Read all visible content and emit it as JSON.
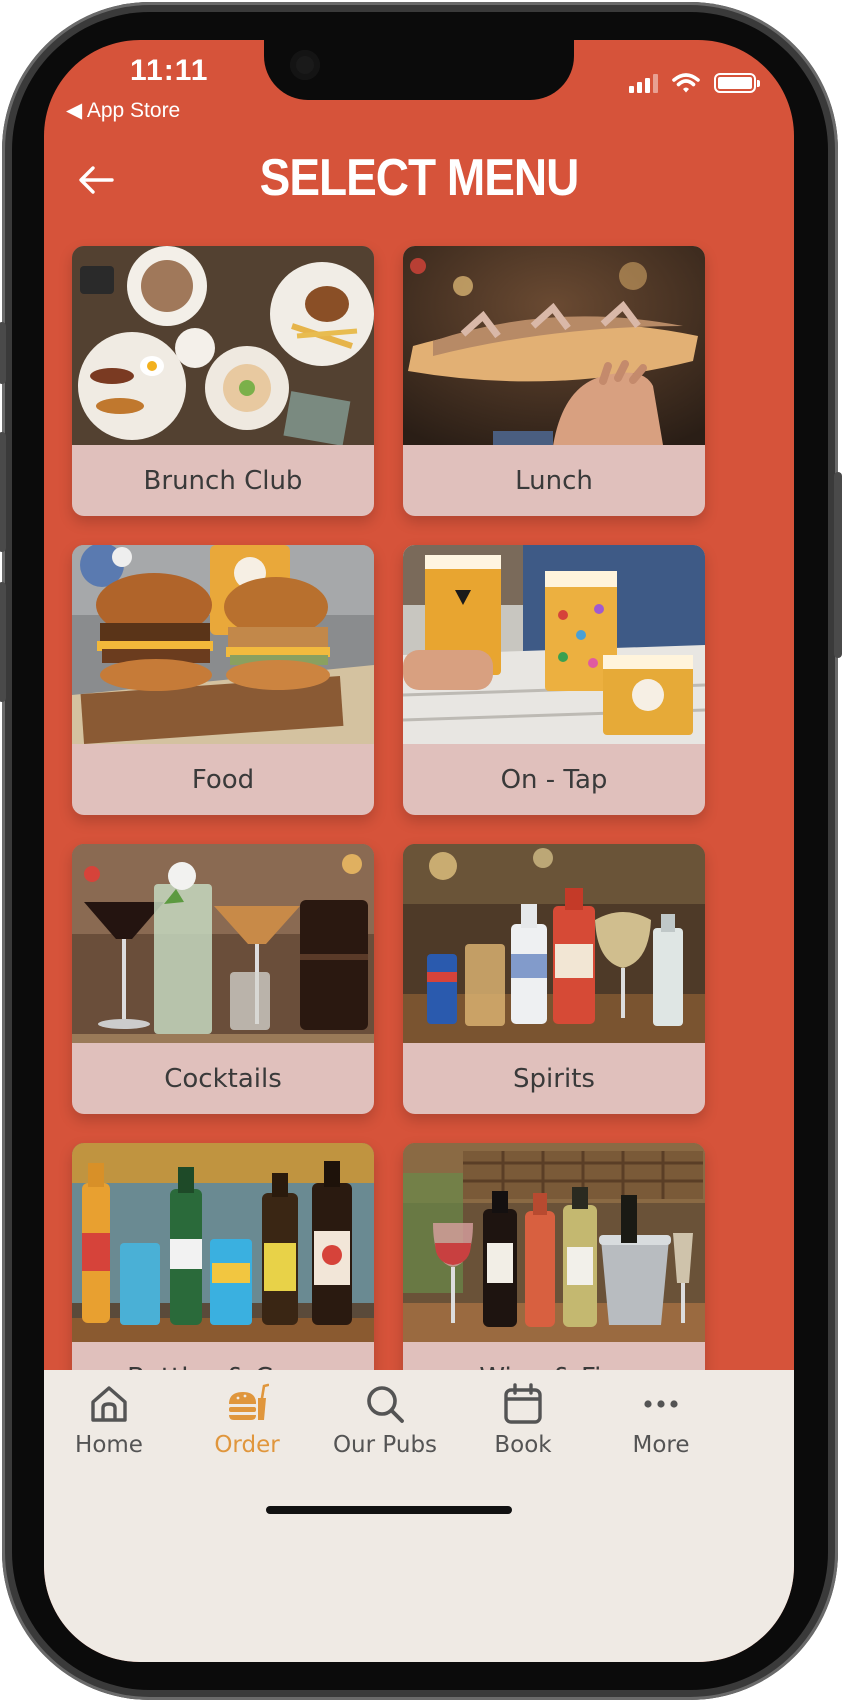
{
  "status_bar": {
    "time": "11:11",
    "back_app": "App Store"
  },
  "header": {
    "title": "SELECT MENU"
  },
  "colors": {
    "background": "#d6533a",
    "card_label_bg": "#e0c0bc",
    "nav_bg": "#efeae4",
    "nav_active": "#e0963c",
    "nav_inactive": "#545454"
  },
  "menus": [
    {
      "label": "Brunch Club",
      "image": "brunch-photo"
    },
    {
      "label": "Lunch",
      "image": "baguette-photo"
    },
    {
      "label": "Food",
      "image": "burgers-photo"
    },
    {
      "label": "On - Tap",
      "image": "beer-photo"
    },
    {
      "label": "Cocktails",
      "image": "cocktails-photo"
    },
    {
      "label": "Spirits",
      "image": "spirits-photo"
    },
    {
      "label": "Bottles & Cans",
      "image": "bottles-photo"
    },
    {
      "label": "Wine & Fizz",
      "image": "wine-photo"
    }
  ],
  "bottom_nav": {
    "items": [
      {
        "label": "Home",
        "icon": "home-icon",
        "active": false
      },
      {
        "label": "Order",
        "icon": "burger-drink-icon",
        "active": true
      },
      {
        "label": "Our Pubs",
        "icon": "search-icon",
        "active": false
      },
      {
        "label": "Book",
        "icon": "calendar-icon",
        "active": false
      },
      {
        "label": "More",
        "icon": "more-icon",
        "active": false
      }
    ]
  }
}
